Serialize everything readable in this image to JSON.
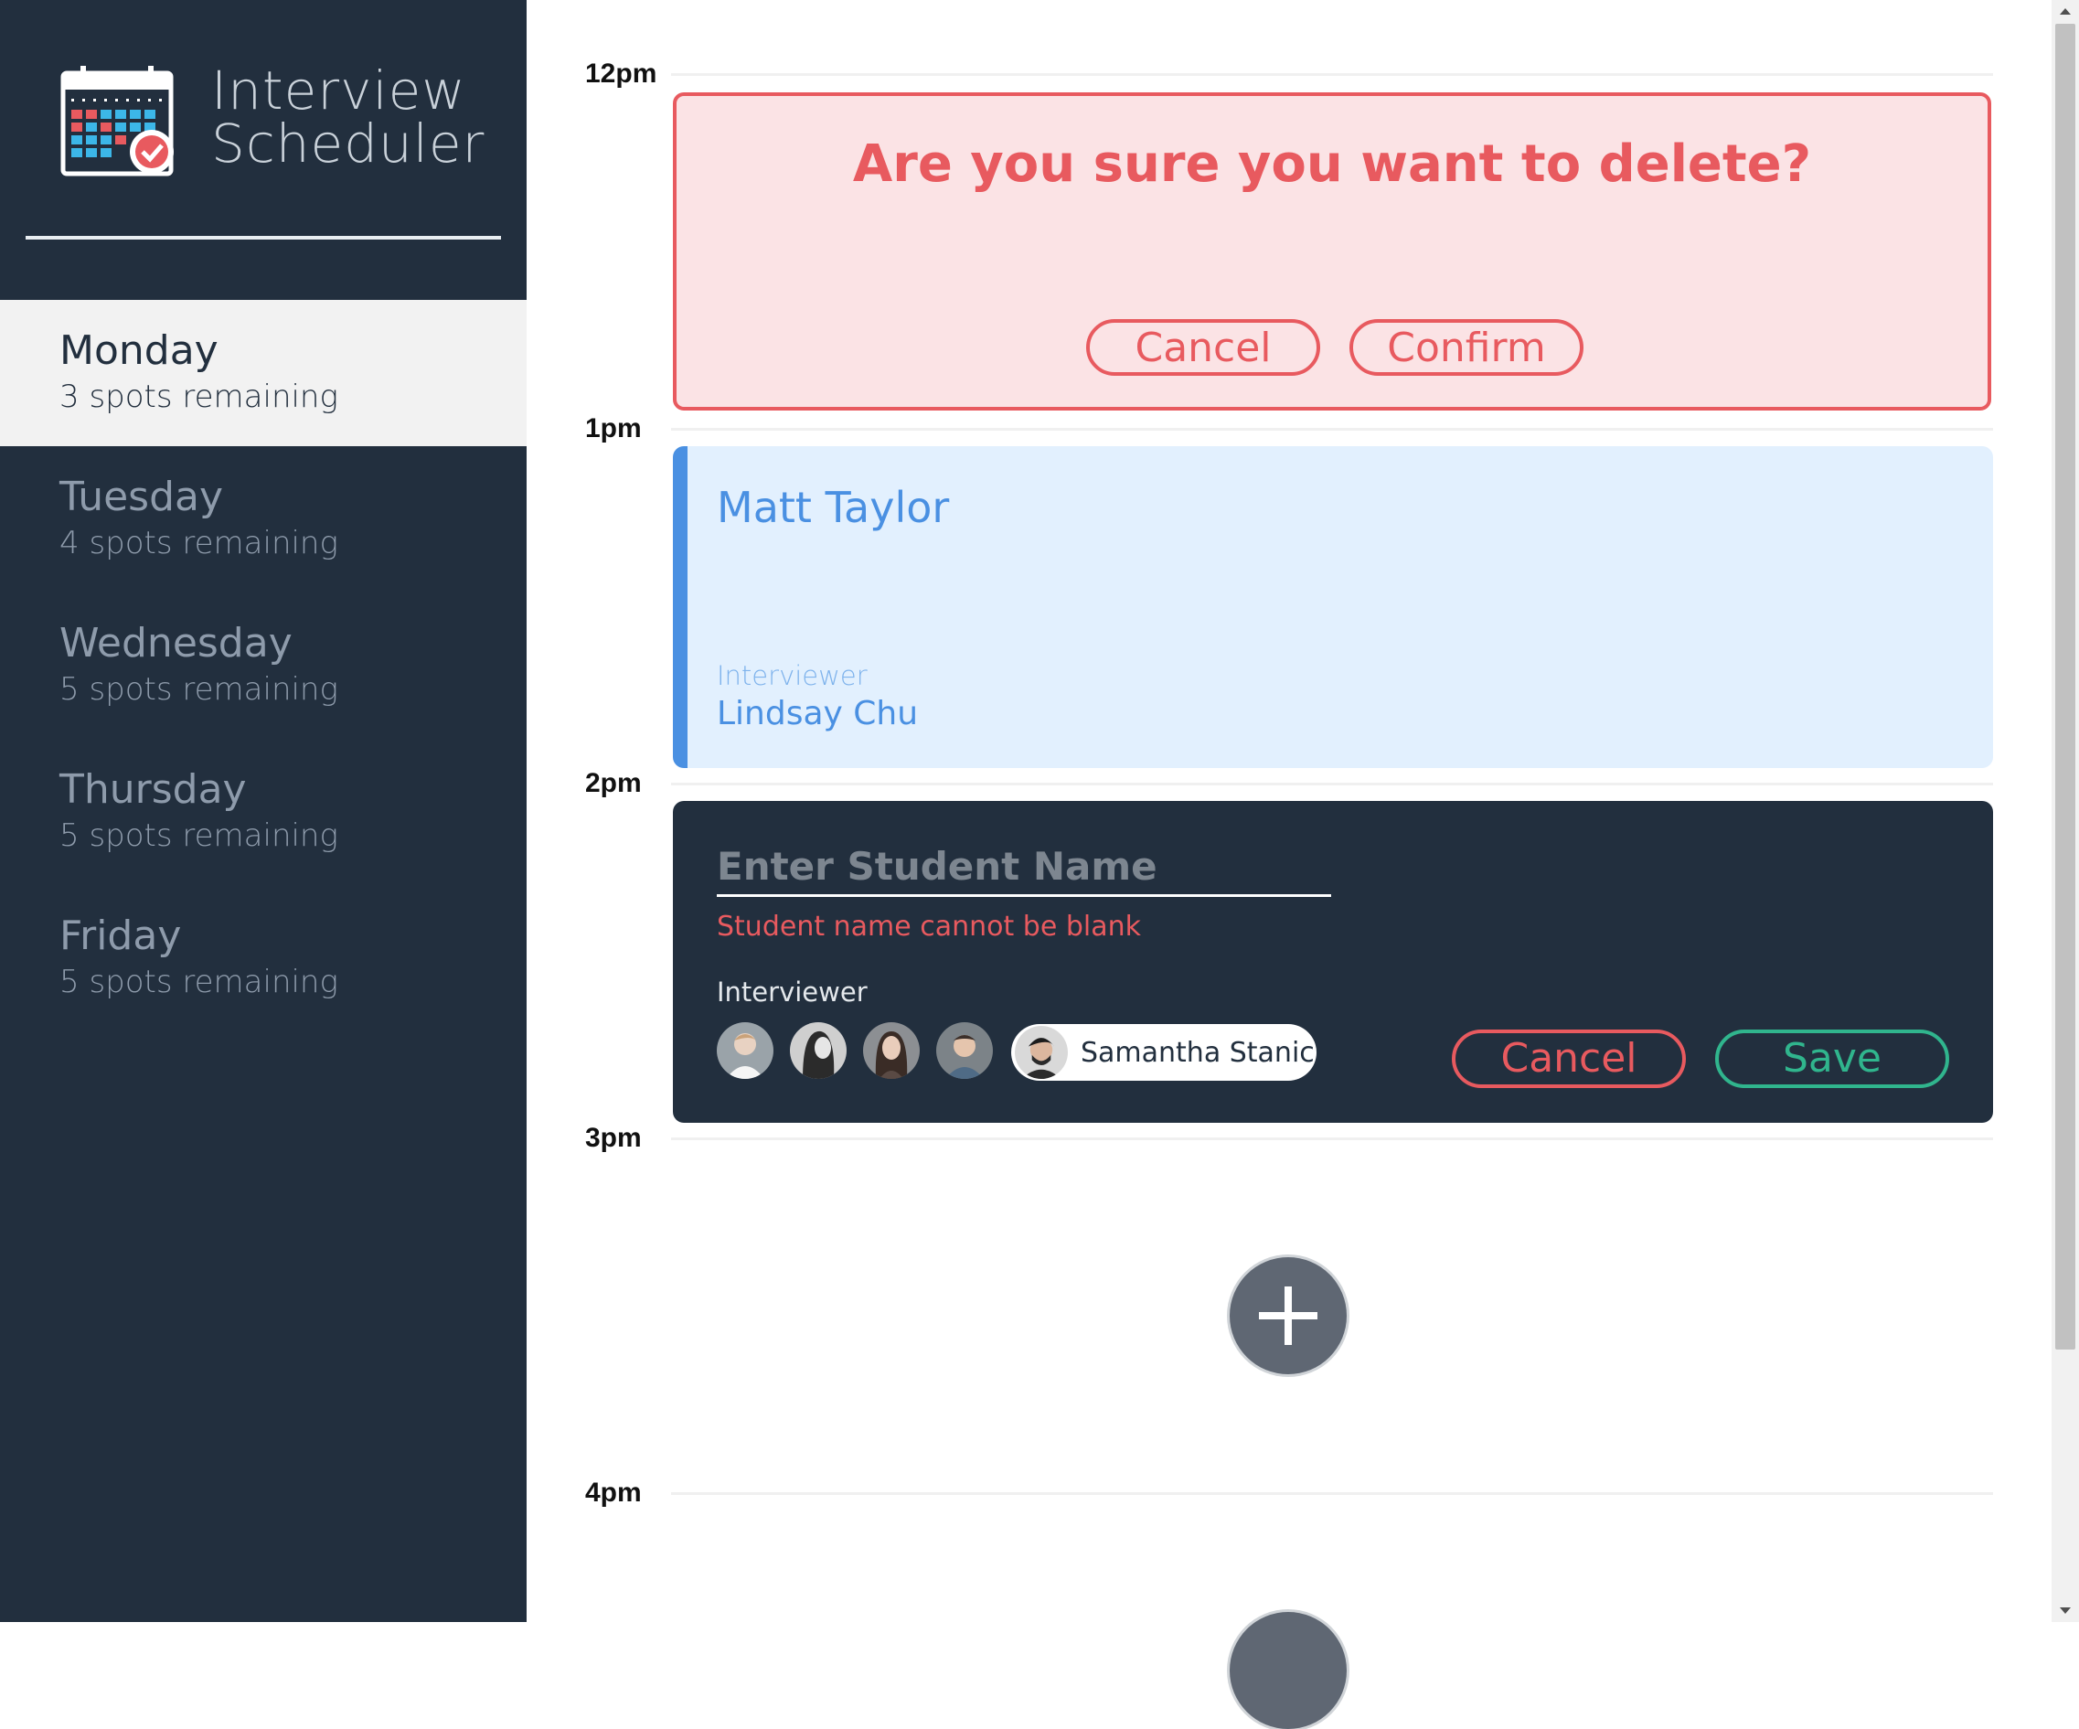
{
  "sidebar": {
    "brand": {
      "line1": "Interview",
      "line2": "Scheduler"
    },
    "days": [
      {
        "name": "Monday",
        "spots": "3 spots remaining",
        "selected": true
      },
      {
        "name": "Tuesday",
        "spots": "4 spots remaining",
        "selected": false
      },
      {
        "name": "Wednesday",
        "spots": "5 spots remaining",
        "selected": false
      },
      {
        "name": "Thursday",
        "spots": "5 spots remaining",
        "selected": false
      },
      {
        "name": "Friday",
        "spots": "5 spots remaining",
        "selected": false
      }
    ]
  },
  "schedule": {
    "times": [
      "12pm",
      "1pm",
      "2pm",
      "3pm",
      "4pm"
    ],
    "confirm": {
      "message": "Are you sure you want to delete?",
      "cancel_label": "Cancel",
      "confirm_label": "Confirm"
    },
    "show": {
      "student": "Matt Taylor",
      "interviewer_label": "Interviewer",
      "interviewer_name": "Lindsay Chu"
    },
    "form": {
      "name_value": "",
      "name_placeholder": "Enter Student Name",
      "validation": "Student name cannot be blank",
      "interviewer_label": "Interviewer",
      "selected_interviewer": "Samantha Stanic",
      "cancel_label": "Cancel",
      "save_label": "Save"
    }
  },
  "colors": {
    "sidebar_bg": "#222f3e",
    "danger": "#e85a5f",
    "primary": "#4a90e2",
    "success": "#30b58d"
  }
}
